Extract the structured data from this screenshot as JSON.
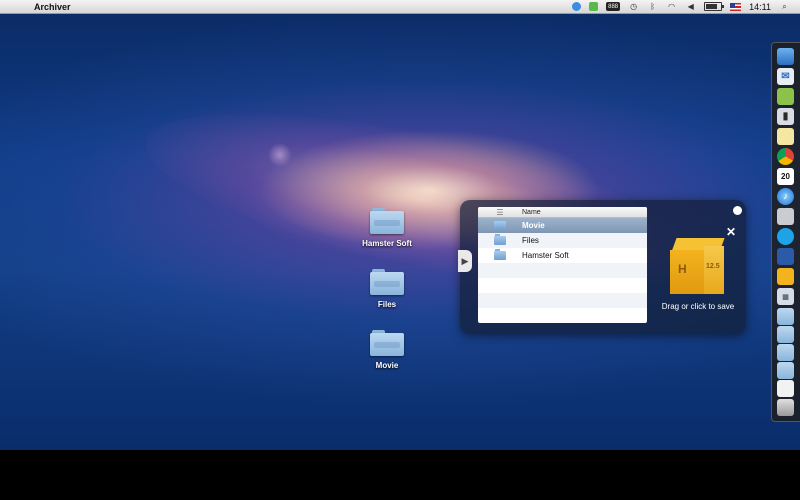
{
  "menubar": {
    "app_name": "Archiver",
    "clock": "14:11",
    "tray_badge": "888"
  },
  "desktop": {
    "icons": [
      {
        "label": "Hamster Soft"
      },
      {
        "label": "Files"
      },
      {
        "label": "Movie"
      }
    ]
  },
  "archiver": {
    "column_header": "Name",
    "files": [
      {
        "name": "Movie",
        "selected": true
      },
      {
        "name": "Files",
        "selected": false
      },
      {
        "name": "Hamster Soft",
        "selected": false
      }
    ],
    "box_letter": "H",
    "box_version": "12.5",
    "drag_text": "Drag or click to save",
    "close_glyph": "✕",
    "expand_glyph": "▶"
  },
  "dock": {
    "items": [
      "finder-icon",
      "mail-icon",
      "android-icon",
      "facetime-icon",
      "notes-icon",
      "chrome-icon",
      "calendar-icon",
      "itunes-icon",
      "preview-icon",
      "skype-icon",
      "word-icon",
      "hamster-icon",
      "folder-icon",
      "folder-icon",
      "folder-icon",
      "folder-icon",
      "document-icon",
      "document-icon",
      "trash-icon"
    ],
    "calendar_day": "20"
  },
  "colors": {
    "accent_box": "#f3b31e",
    "selection": "#8ea6c1",
    "panel_bg": "#1e2a45"
  }
}
